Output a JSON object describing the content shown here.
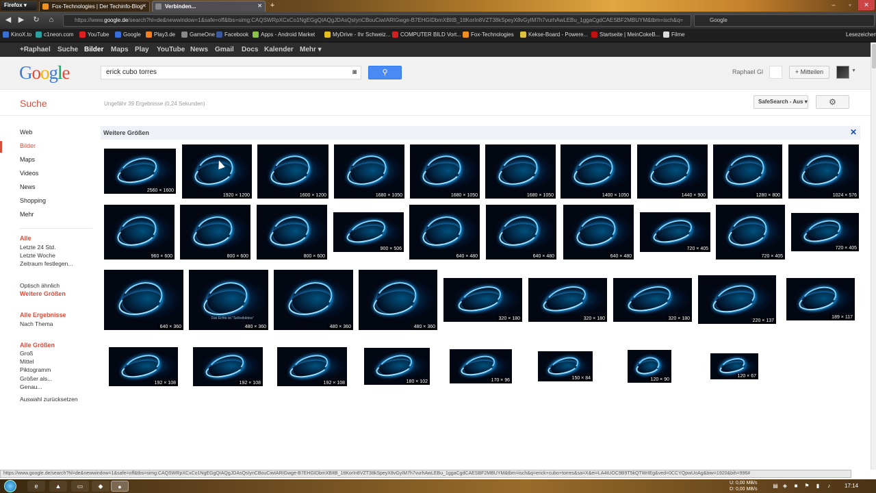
{
  "browser": {
    "menu_label": "Firefox ▾",
    "tabs": [
      {
        "label": "Fox-Technologies | Der Techinfo-Blog",
        "active": false
      },
      {
        "label": "Verbinden...",
        "active": true
      }
    ],
    "url_prefix": "https://www.",
    "url_domain": "google.de",
    "url_rest": "/search?hl=de&newwindow=1&safe=off&tbs=simg:CAQSWRpXCxCo1NgEGgQIAQgJDAsQsIynCBouCiwIARIGwge-B7EHGIDbmXBItB_1ttKorIn8VZT38kSpeyX8vGyIM7h7vurhAwLEBu_1ggaCgdCAESBF2MBUYM&tbm=isch&q=",
    "search_engine": "Google",
    "new_tab": "+"
  },
  "bookmarks": [
    {
      "label": "KinoX.to",
      "color": "#3a6fd0"
    },
    {
      "label": "c1neon.com",
      "color": "#2aa0a0"
    },
    {
      "label": "YouTube",
      "color": "#e02020"
    },
    {
      "label": "Google",
      "color": "#3b6fd8"
    },
    {
      "label": "Play3.de",
      "color": "#f08020"
    },
    {
      "label": "GameOne",
      "color": "#888888"
    },
    {
      "label": "Facebook",
      "color": "#3b5998"
    },
    {
      "label": "Apps - Android Market",
      "color": "#8bc34a"
    },
    {
      "label": "MyDrive - Ihr Schweiz...",
      "color": "#e0c020"
    },
    {
      "label": "COMPUTER BILD Vort...",
      "color": "#d02020"
    },
    {
      "label": "Fox-Technologies",
      "color": "#f09020"
    },
    {
      "label": "Kekse-Board - Powere...",
      "color": "#e0c040"
    },
    {
      "label": "Startseite | MeinCokeB...",
      "color": "#c01010"
    },
    {
      "label": "Filme",
      "color": "#dddddd"
    }
  ],
  "bookmarks_right": "Lesezeichen",
  "gbar": [
    "+Raphael",
    "Suche",
    "Bilder",
    "Maps",
    "Play",
    "YouTube",
    "News",
    "Gmail",
    "Docs",
    "Kalender",
    "Mehr ▾"
  ],
  "header": {
    "query": "erick cubo torres",
    "user": "Raphael Gl",
    "share": "+ Mitteilen"
  },
  "subheader": {
    "title": "Suche",
    "stats": "Ungefähr 39 Ergebnisse (0,24 Sekunden)",
    "safesearch": "SafeSearch - Aus ▾"
  },
  "sidebar": {
    "types": [
      "Web",
      "Bilder",
      "Maps",
      "Videos",
      "News",
      "Shopping",
      "Mehr"
    ],
    "time_head": "Alle",
    "time": [
      "Letzte 24 Std.",
      "Letzte Woche",
      "Zeitraum festlegen..."
    ],
    "similar": "Optisch ähnlich",
    "larger": "Weitere Größen",
    "results_head": "Alle Ergebnisse",
    "results": [
      "Nach Thema"
    ],
    "size_head": "Alle Größen",
    "sizes": [
      "Groß",
      "Mittel",
      "Piktogramm",
      "Größer als...",
      "Genau..."
    ],
    "reset": "Auswahl zurücksetzen"
  },
  "panel": {
    "title": "Weitere Größen",
    "close": "✕"
  },
  "thumbnails": [
    "2560 × 1600",
    "1920 × 1200",
    "1600 × 1200",
    "1680 × 1050",
    "1680 × 1050",
    "1680 × 1050",
    "1400 × 1050",
    "1440 × 900",
    "1280 × 800",
    "1024 × 576",
    "960 × 600",
    "800 × 600",
    "800 × 600",
    "900 × 506",
    "640 × 480",
    "640 × 480",
    "640 × 480",
    "720 × 405",
    "720 × 405",
    "720 × 405",
    "640 × 360",
    "480 × 360",
    "480 × 360",
    "480 × 360",
    "320 × 180",
    "320 × 180",
    "320 × 180",
    "220 × 137",
    "189 × 117",
    "192 × 108",
    "192 × 108",
    "192 × 108",
    "180 × 102",
    "170 × 96",
    "150 × 84",
    "120 × 90",
    "120 × 67"
  ],
  "thumbnail_caption": "Das Echte ist \"Selbstbildnis\"",
  "status_url": "https://www.google.de/search?hl=de&newwindow=1&safe=off&tbs=simg:CAQSWRpXCxCo1NgEGgQIAQgJDAsQsIynCBouCiwIARIGwge-B7EHGIDbmXBItB_1ttKorIn8VZT38kSpeyX8vGyIM7h7vurhAwLEBu_1ggaCgdCAESBF2MBUYM&tbm=isch&q=erick+cubo+torres&sa=X&ei=LA4tUOC9B9T5kQTWrIEg&ved=0CCYQpwUoAg&biw=1920&bih=996#",
  "taskbar": {
    "upload": "U:    0,00 MB/s",
    "download": "D:    0,00 MB/s",
    "time": "17:14"
  }
}
